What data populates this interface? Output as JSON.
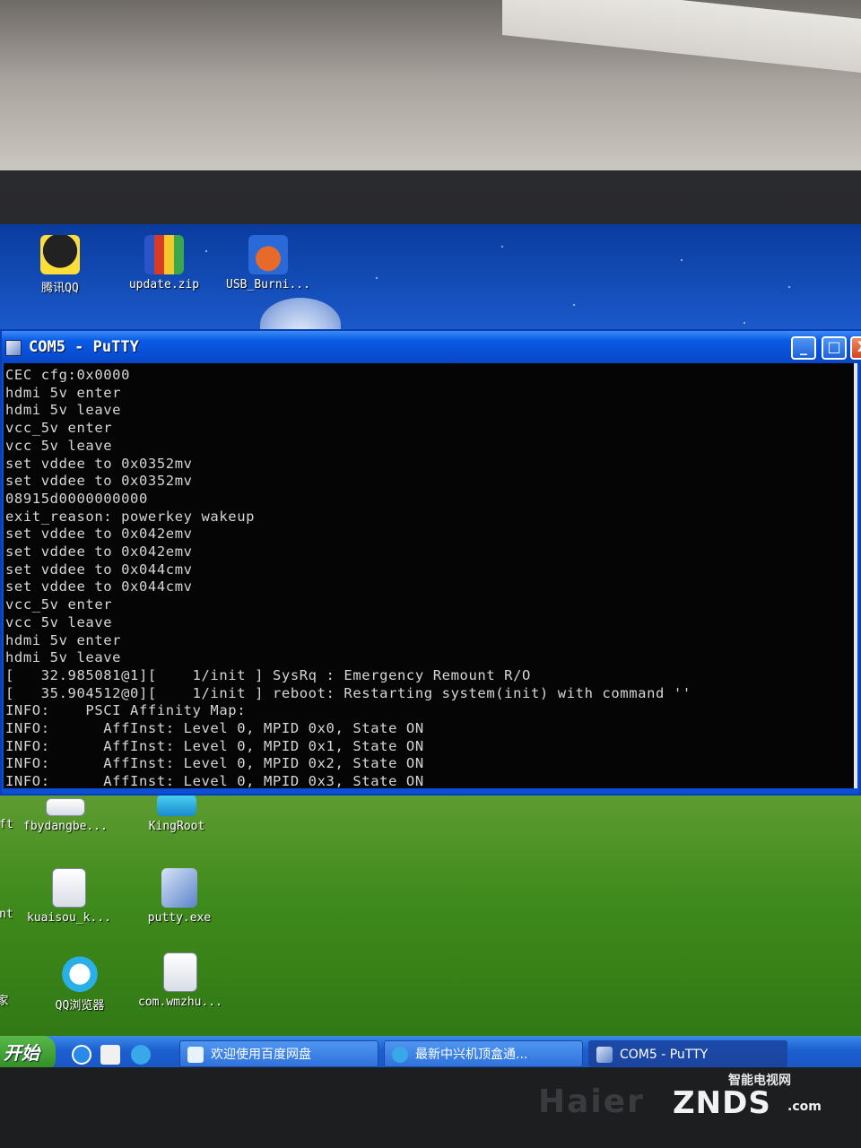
{
  "desktop": {
    "icons": [
      {
        "label": "腾讯QQ",
        "icon": "qq-penguin-icon"
      },
      {
        "label": "update.zip",
        "icon": "winrar-archive-icon"
      },
      {
        "label": "USB_Burni...",
        "icon": "usb-burning-tool-icon"
      },
      {
        "label": "fbydangbe...",
        "icon": "document-icon"
      },
      {
        "label": "KingRoot",
        "icon": "kingroot-icon"
      },
      {
        "label": "kuaisou_k...",
        "icon": "document-icon"
      },
      {
        "label": "putty.exe",
        "icon": "putty-icon"
      },
      {
        "label": "QQ浏览器",
        "icon": "qq-browser-icon"
      },
      {
        "label": "com.wmzhu...",
        "icon": "document-icon"
      },
      {
        "label": "ft",
        "icon": "partial-icon"
      },
      {
        "label": "nt",
        "icon": "partial-icon"
      },
      {
        "label": "家",
        "icon": "partial-icon"
      }
    ]
  },
  "window": {
    "title": "COM5 - PuTTY",
    "minimize_label": "_",
    "maximize_label": "□",
    "close_label": "X"
  },
  "terminal": {
    "lines": [
      "CEC cfg:0x0000",
      "hdmi 5v enter",
      "hdmi 5v leave",
      "vcc_5v enter",
      "vcc 5v leave",
      "set vddee to 0x0352mv",
      "set vddee to 0x0352mv",
      "08915d0000000000",
      "exit_reason: powerkey wakeup",
      "set vddee to 0x042emv",
      "set vddee to 0x042emv",
      "set vddee to 0x044cmv",
      "set vddee to 0x044cmv",
      "vcc_5v enter",
      "vcc 5v leave",
      "hdmi 5v enter",
      "hdmi 5v leave",
      "[   32.985081@1][    1/init ] SysRq : Emergency Remount R/O",
      "[   35.904512@0][    1/init ] reboot: Restarting system(init) with command ''",
      "INFO:    PSCI Affinity Map:",
      "INFO:      AffInst: Level 0, MPID 0x0, State ON",
      "INFO:      AffInst: Level 0, MPID 0x1, State ON",
      "INFO:      AffInst: Level 0, MPID 0x2, State ON",
      "INFO:      AffInst: Level 0, MPID 0x3, State ON"
    ]
  },
  "taskbar": {
    "start_label": "开始",
    "tasks": [
      {
        "label": "欢迎使用百度网盘",
        "icon": "baidu-netdisk-icon"
      },
      {
        "label": "最新中兴机顶盒通...",
        "icon": "qq-browser-icon"
      },
      {
        "label": "COM5 - PuTTY",
        "icon": "putty-icon"
      }
    ]
  },
  "monitor": {
    "brand": "Haier"
  },
  "watermark": {
    "top": "智能电视网",
    "main": "ZNDS",
    "sub": ".com"
  },
  "colors": {
    "terminal_bg": "#050505",
    "terminal_fg": "#d6d6d6",
    "titlebar": "#0a5ae6",
    "taskbar": "#1c5fd0"
  }
}
